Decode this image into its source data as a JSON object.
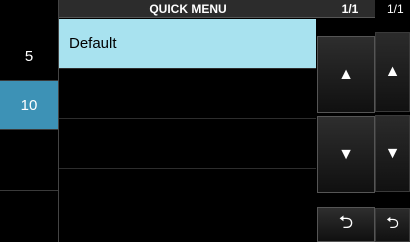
{
  "background": {
    "rows": [
      {
        "label": "5",
        "selected": false
      },
      {
        "label": "10",
        "selected": true
      },
      {
        "label": "",
        "selected": false
      },
      {
        "label": "",
        "selected": false
      }
    ],
    "pager_partial": "1/1",
    "buttons": {
      "up_icon": "▲",
      "down_icon": "▼",
      "back_icon": "⮌"
    }
  },
  "dialog": {
    "title": "QUICK MENU",
    "page_indicator": "1/1",
    "items": [
      {
        "label": "Default",
        "selected": true
      },
      {
        "label": "",
        "selected": false
      },
      {
        "label": "",
        "selected": false
      },
      {
        "label": "",
        "selected": false
      }
    ],
    "buttons": {
      "up_icon": "▲",
      "down_icon": "▼",
      "back_icon": "⮌"
    }
  },
  "colors": {
    "selection_blue": "#3d92b6",
    "item_highlight": "#a8e2ef"
  }
}
